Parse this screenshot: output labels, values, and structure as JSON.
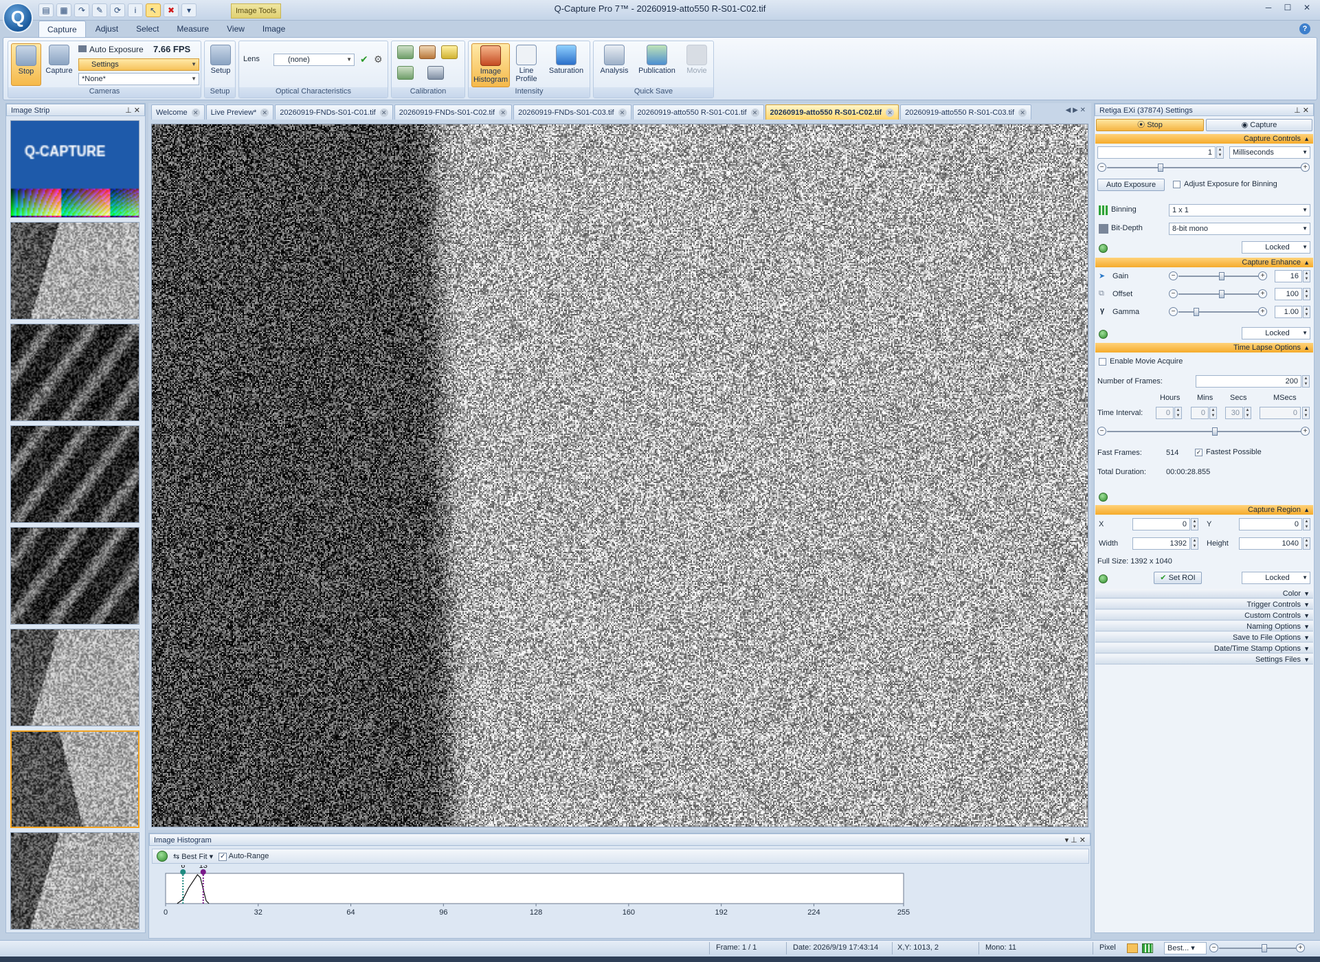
{
  "app": {
    "window_title": "Q-Capture Pro 7™ - 20260919-atto550 R-S01-C02.tif",
    "tool_tab": "Image Tools",
    "ribbon_tabs": [
      "Capture",
      "Adjust",
      "Select",
      "Measure",
      "View",
      "Image"
    ],
    "selected_ribbon_tab": "Capture"
  },
  "ribbon": {
    "cameras": {
      "label": "Cameras",
      "stop": "Stop",
      "capture": "Capture",
      "auto_exposure": "Auto Exposure",
      "fps": "7.66 FPS",
      "settings": "Settings",
      "preset": "*None*"
    },
    "setup": {
      "label": "Setup",
      "button": "Setup"
    },
    "optical": {
      "label": "Optical Characteristics",
      "lens_label": "Lens",
      "lens_value": "(none)"
    },
    "calibration": {
      "label": "Calibration"
    },
    "intensity": {
      "label": "Intensity",
      "histogram_line1": "Image",
      "histogram_line2": "Histogram",
      "line_profile_line1": "Line",
      "line_profile_line2": "Profile",
      "saturation": "Saturation"
    },
    "quick_save": {
      "label": "Quick Save",
      "analysis": "Analysis",
      "publication": "Publication",
      "movie": "Movie"
    }
  },
  "image_strip": {
    "title": "Image Strip",
    "thumbnail_count": 8,
    "selected_index": 6
  },
  "doc_tabs": [
    {
      "label": "Welcome",
      "selected": false
    },
    {
      "label": "Live Preview*",
      "selected": false
    },
    {
      "label": "20260919-FNDs-S01-C01.tif",
      "selected": false
    },
    {
      "label": "20260919-FNDs-S01-C02.tif",
      "selected": false
    },
    {
      "label": "20260919-FNDs-S01-C03.tif",
      "selected": false
    },
    {
      "label": "20260919-atto550 R-S01-C01.tif",
      "selected": false
    },
    {
      "label": "20260919-atto550 R-S01-C02.tif",
      "selected": true
    },
    {
      "label": "20260919-atto550 R-S01-C03.tif",
      "selected": false
    }
  ],
  "histogram": {
    "title": "Image Histogram",
    "fit": "Best Fit",
    "auto_range": "Auto-Range",
    "auto_range_checked": true,
    "low_marker": 6,
    "high_marker": 13,
    "low_label": "6",
    "high_label": "13",
    "ticks": [
      "0",
      "32",
      "64",
      "96",
      "128",
      "160",
      "192",
      "224",
      "255"
    ],
    "tick_values": [
      0,
      32,
      64,
      96,
      128,
      160,
      192,
      224,
      255
    ],
    "xmax": 255,
    "curve": [
      [
        4,
        0
      ],
      [
        6,
        0.15
      ],
      [
        8,
        0.55
      ],
      [
        10,
        0.85
      ],
      [
        11,
        1.0
      ],
      [
        12,
        0.9
      ],
      [
        13,
        0.5
      ],
      [
        14,
        0.1
      ],
      [
        15,
        0
      ]
    ]
  },
  "settings": {
    "title": "Retiga EXi (37874) Settings",
    "stop_tab": "Stop",
    "capture_tab": "Capture",
    "capture_controls": {
      "header": "Capture Controls",
      "exposure": "1",
      "unit": "Milliseconds",
      "exposure_slider_fraction": 0.27,
      "auto_exposure": "Auto Exposure",
      "adjust_binning": "Adjust Exposure for Binning",
      "binning_label": "Binning",
      "binning_value": "1 x 1",
      "bitdepth_label": "Bit-Depth",
      "bitdepth_value": "8-bit mono",
      "locked": "Locked"
    },
    "capture_enhance": {
      "header": "Capture Enhance",
      "gain_label": "Gain",
      "gain_value": "16",
      "gain_fraction": 0.55,
      "offset_label": "Offset",
      "offset_value": "100",
      "offset_fraction": 0.55,
      "gamma_label": "Gamma",
      "gamma_value": "1.00",
      "gamma_fraction": 0.2,
      "locked": "Locked"
    },
    "time_lapse": {
      "header": "Time Lapse Options",
      "enable_movie": "Enable Movie Acquire",
      "frames_label": "Number of  Frames:",
      "frames_value": "200",
      "hours": "Hours",
      "mins": "Mins",
      "secs": "Secs",
      "msecs": "MSecs",
      "interval_label": "Time Interval:",
      "h": "0",
      "m": "0",
      "s": "30",
      "ms": "0",
      "interval_slider_fraction": 0.56,
      "fast_frames_label": "Fast Frames:",
      "fast_frames_value": "514",
      "fastest": "Fastest Possible",
      "fastest_checked": true,
      "total_label": "Total Duration:",
      "total_value": "00:00:28.855"
    },
    "capture_region": {
      "header": "Capture Region",
      "x_label": "X",
      "x_value": "0",
      "y_label": "Y",
      "y_value": "0",
      "w_label": "Width",
      "w_value": "1392",
      "h_label": "Height",
      "h_value": "1040",
      "full_size": "Full Size: 1392 x 1040",
      "set_roi": "Set ROI",
      "locked": "Locked"
    },
    "collapsed_sections": [
      "Color",
      "Trigger Controls",
      "Custom Controls",
      "Naming Options",
      "Save to File Options",
      "Date/Time Stamp Options",
      "Settings Files"
    ]
  },
  "status": {
    "frame": "Frame: 1 / 1",
    "date": "Date: 2026/9/19 17:43:14",
    "xy": "X,Y: 1013,    2",
    "mono": "Mono:    11",
    "pixel": "Pixel",
    "zoom": "Best..."
  },
  "colors": {
    "accent": "#f5ab2c",
    "low_marker": "#1e8a80",
    "high_marker": "#7a1a8a"
  }
}
